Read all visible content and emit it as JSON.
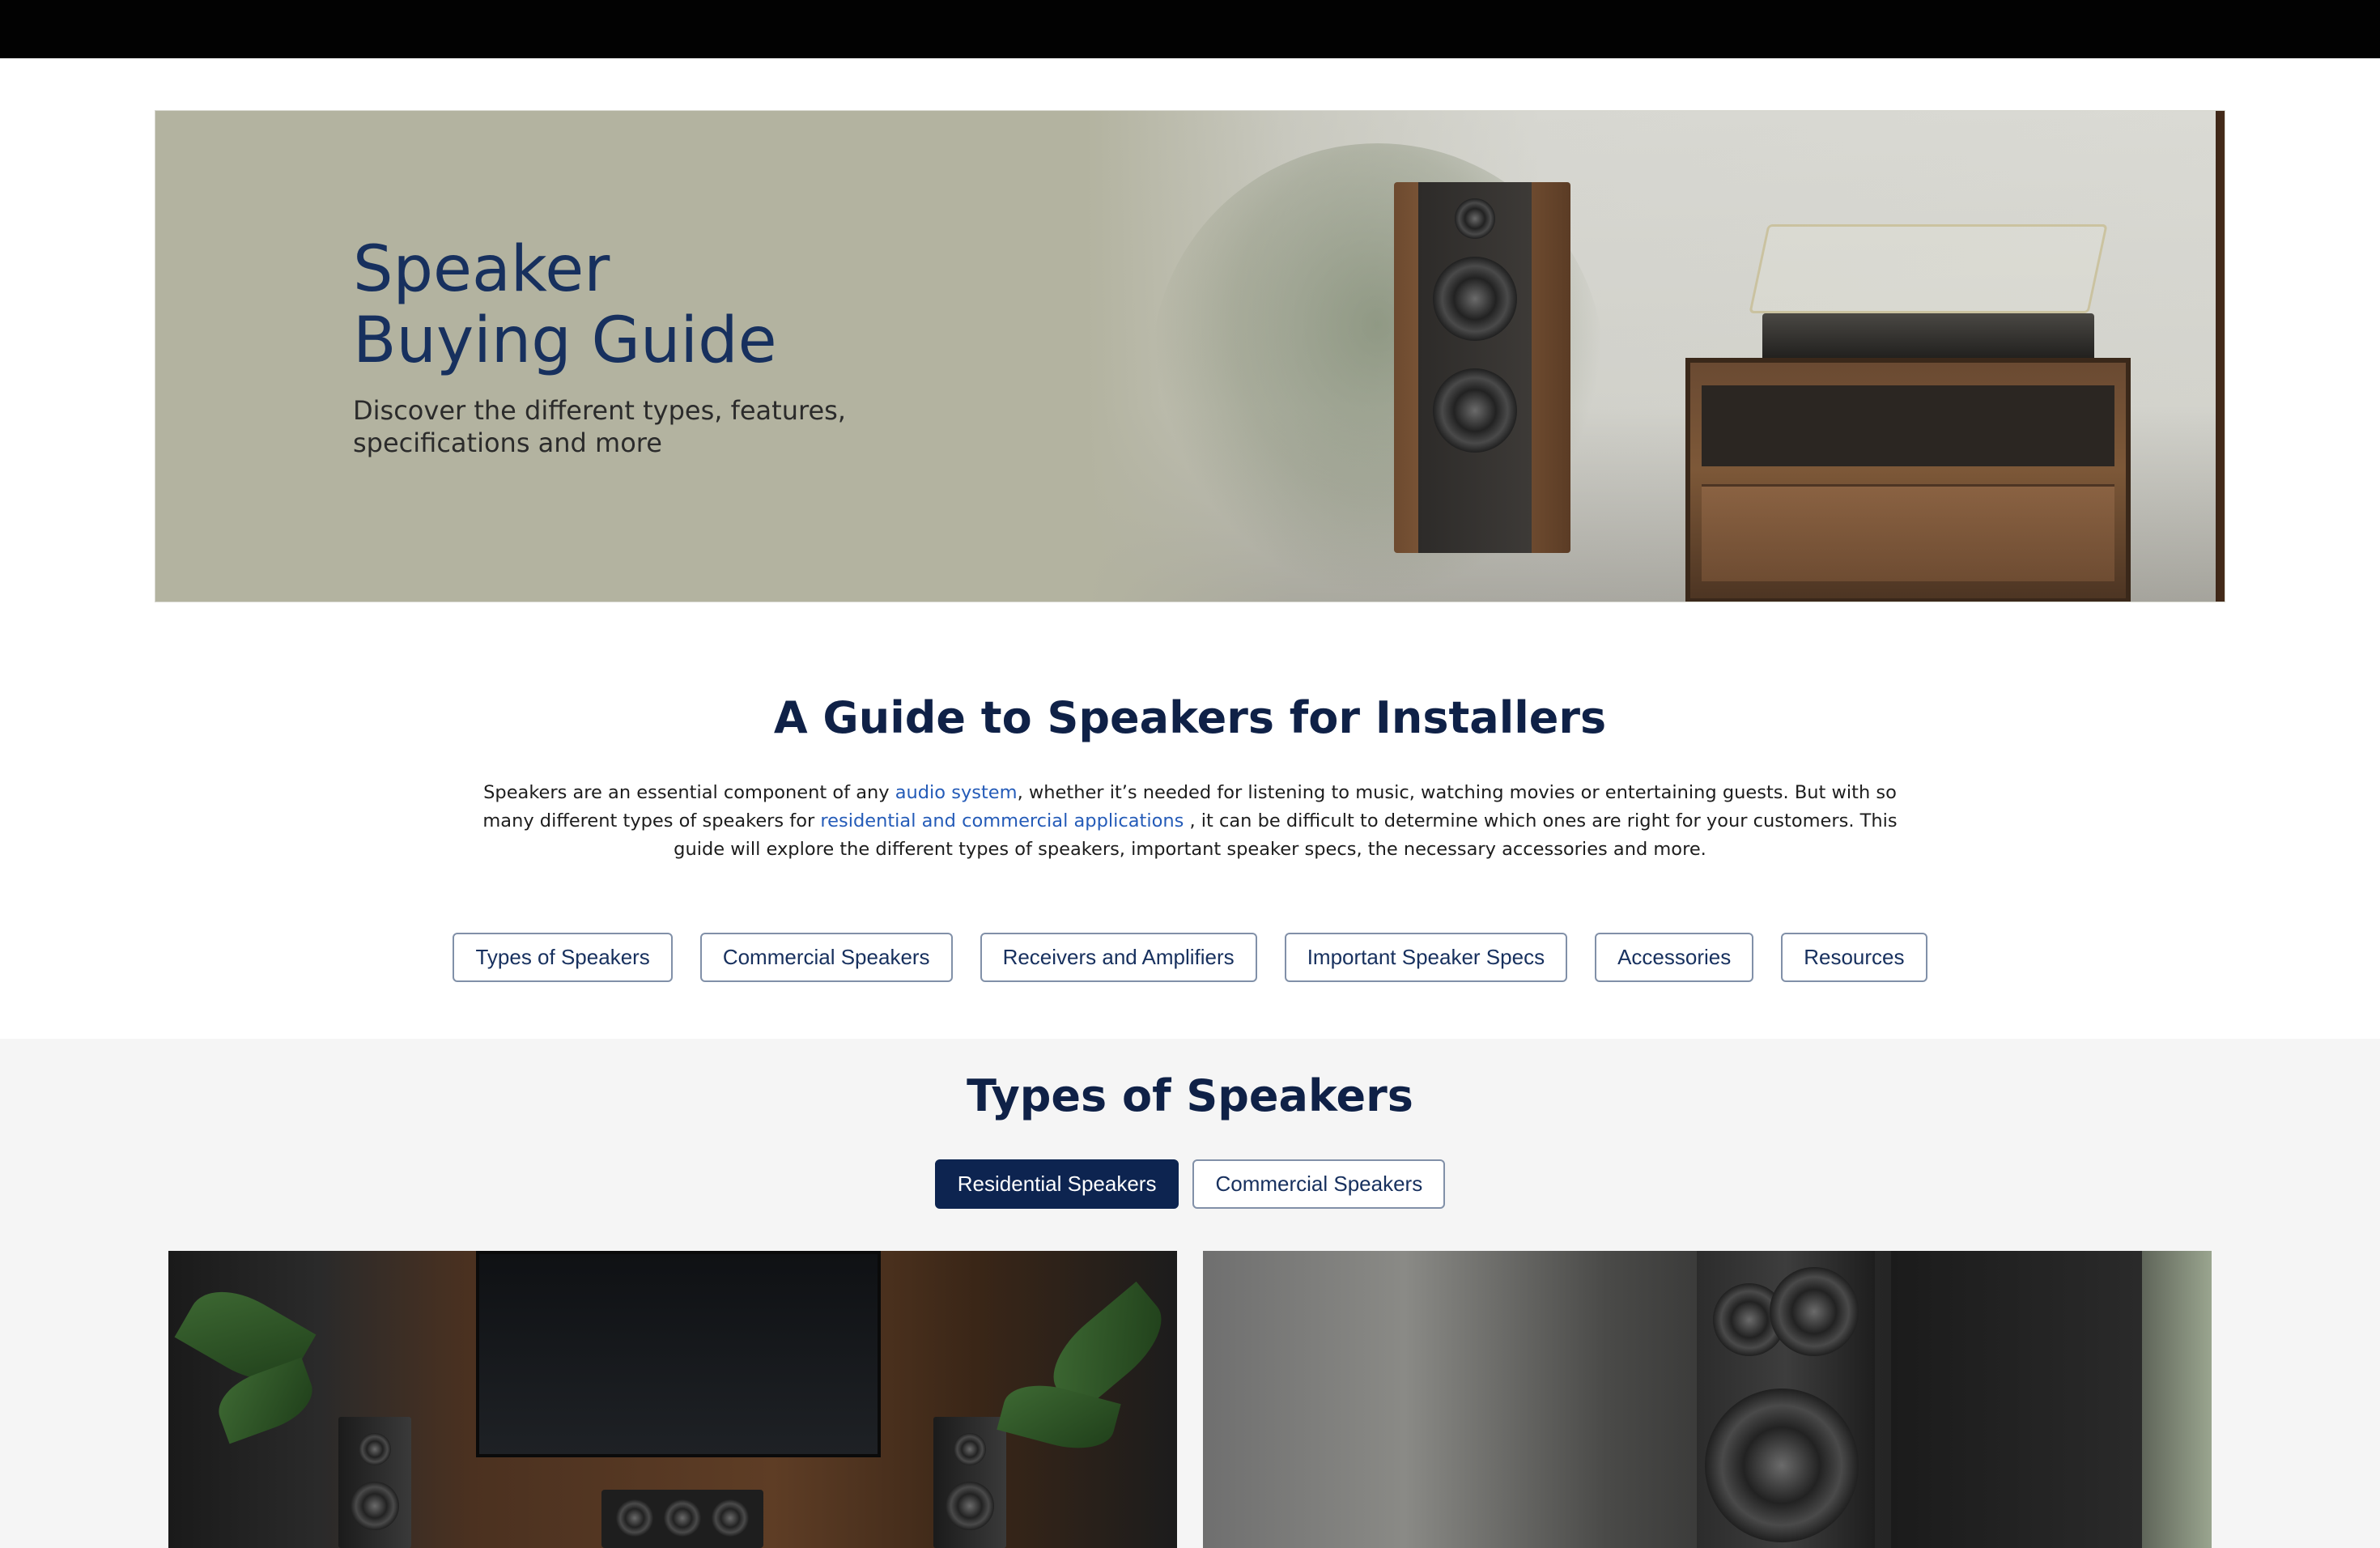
{
  "hero": {
    "title_line1": "Speaker",
    "title_line2": "Buying Guide",
    "subtitle": "Discover the different types, features, specifications and more"
  },
  "intro": {
    "title": "A Guide to Speakers for Installers",
    "text_part1": "Speakers are an essential component of any ",
    "link1": "audio system",
    "text_part2": ", whether it’s needed for listening to music, watching movies or entertaining guests. But with so many different types of speakers for ",
    "link2": "residential and commercial applications",
    "text_part3": " , it can be difficult to determine which ones are right for your customers. This guide will explore the different types of speakers, important speaker specs, the necessary accessories and more."
  },
  "nav": {
    "items": [
      {
        "label": "Types of Speakers"
      },
      {
        "label": "Commercial Speakers"
      },
      {
        "label": "Receivers and Amplifiers"
      },
      {
        "label": "Important Speaker Specs"
      },
      {
        "label": "Accessories"
      },
      {
        "label": "Resources"
      }
    ]
  },
  "types": {
    "title": "Types of Speakers",
    "tabs": [
      {
        "label": "Residential Speakers",
        "active": true
      },
      {
        "label": "Commercial Speakers",
        "active": false
      }
    ]
  },
  "colors": {
    "navy": "#0f2147",
    "link": "#245bb8",
    "hero_bg": "#b3b3a0",
    "section_bg": "#f5f5f5"
  }
}
